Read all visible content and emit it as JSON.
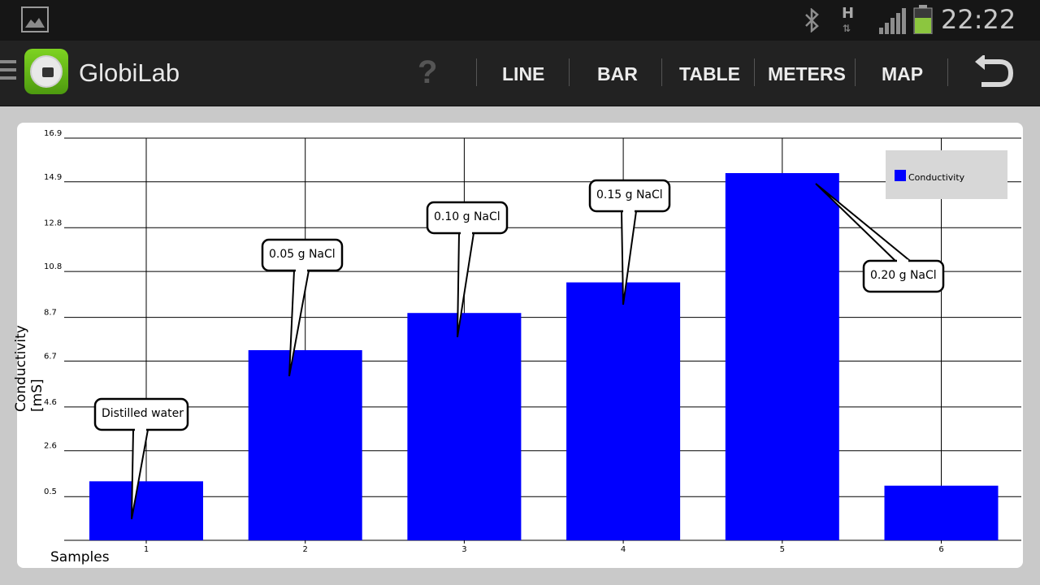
{
  "status_bar": {
    "time": "22:22",
    "network_label": "H",
    "icons": [
      "gallery-icon",
      "bluetooth-icon",
      "h-network-icon",
      "signal-icon",
      "battery-icon"
    ]
  },
  "action_bar": {
    "app_title": "GlobiLab",
    "help_label": "?",
    "tabs": [
      {
        "label": "LINE"
      },
      {
        "label": "BAR"
      },
      {
        "label": "TABLE"
      },
      {
        "label": "METERS"
      },
      {
        "label": "MAP"
      }
    ],
    "icons": [
      "menu-icon",
      "app-logo",
      "back-icon"
    ]
  },
  "colors": {
    "bar": "#0000ff",
    "brand_green": "#7ed321",
    "action_bar_bg": "#222222",
    "status_bar_bg": "#161616",
    "legend_bg": "#d7d7d7"
  },
  "chart_data": {
    "type": "bar",
    "categories": [
      "1",
      "2",
      "3",
      "4",
      "5",
      "6"
    ],
    "series": [
      {
        "name": "Conductivity",
        "values": [
          1.2,
          7.2,
          8.9,
          10.3,
          15.3,
          1.0
        ]
      }
    ],
    "xlabel": "Samples",
    "ylabel": "Conductivity [mS]",
    "y_ticks": [
      "0.5",
      "2.6",
      "4.6",
      "6.7",
      "8.7",
      "10.8",
      "12.8",
      "14.9",
      "16.9"
    ],
    "ylim": [
      -1.5,
      16.9
    ],
    "grid": true,
    "legend_position": "top-right",
    "annotations": [
      {
        "category": "1",
        "text": "Distilled water"
      },
      {
        "category": "2",
        "text": "0.05 g NaCl"
      },
      {
        "category": "3",
        "text": "0.10 g NaCl"
      },
      {
        "category": "4",
        "text": "0.15 g NaCl"
      },
      {
        "category": "5",
        "text": "0.20 g NaCl"
      }
    ]
  }
}
